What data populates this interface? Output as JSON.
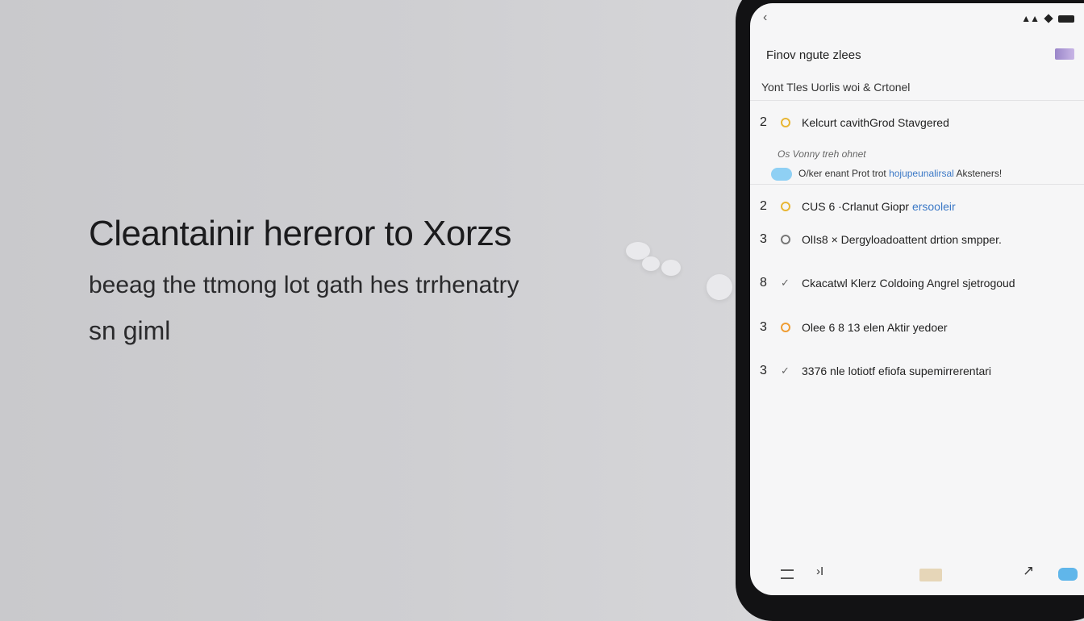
{
  "hero": {
    "title": "Cleantainir hereror to Xorzs",
    "subtitle": "beeag the ttmong lot gath hes trrhenatry",
    "tagline": "sn giml"
  },
  "phone": {
    "status": {
      "back": "‹",
      "signal": "▲▲"
    },
    "section_title": "Finov ngute zlees",
    "subheader": "Yont  Tles Uorlis  woi & Crtonel",
    "items": [
      {
        "num": "2",
        "marker": "yellow",
        "text": "Kelcurt cavithGrod  Stavgered"
      },
      {
        "num": "2",
        "marker": "yellow",
        "text": "CUS 6 ·Crlanut  Giopr",
        "link": "ersooleir"
      },
      {
        "num": "3",
        "marker": "gray",
        "text": "OlIs8  ×  Dergyloadoattent drtion smpper."
      },
      {
        "num": "8",
        "marker": "check",
        "text": "Ckacatwl  Klerz  Coldoing Angrel  sjetrogoud"
      },
      {
        "num": "3",
        "marker": "orange",
        "text": "Olee  6  8 13    elen Aktir yedoer"
      },
      {
        "num": "3",
        "marker": "check",
        "text": "3376   nle lotiotf   efiofa supemirrerentari"
      }
    ],
    "meta": "Os  Vonny treh ohnet",
    "meta_line": "O/ker enant Prot trot",
    "meta_link": "hojupeunalirsal",
    "meta_line_tail": "Aksteners!",
    "nav": {
      "forward": "›I",
      "share": "↗"
    }
  },
  "colors": {
    "accent_blue": "#60b6ea",
    "marker_yellow": "#e8b634",
    "marker_orange": "#ef9d33"
  }
}
